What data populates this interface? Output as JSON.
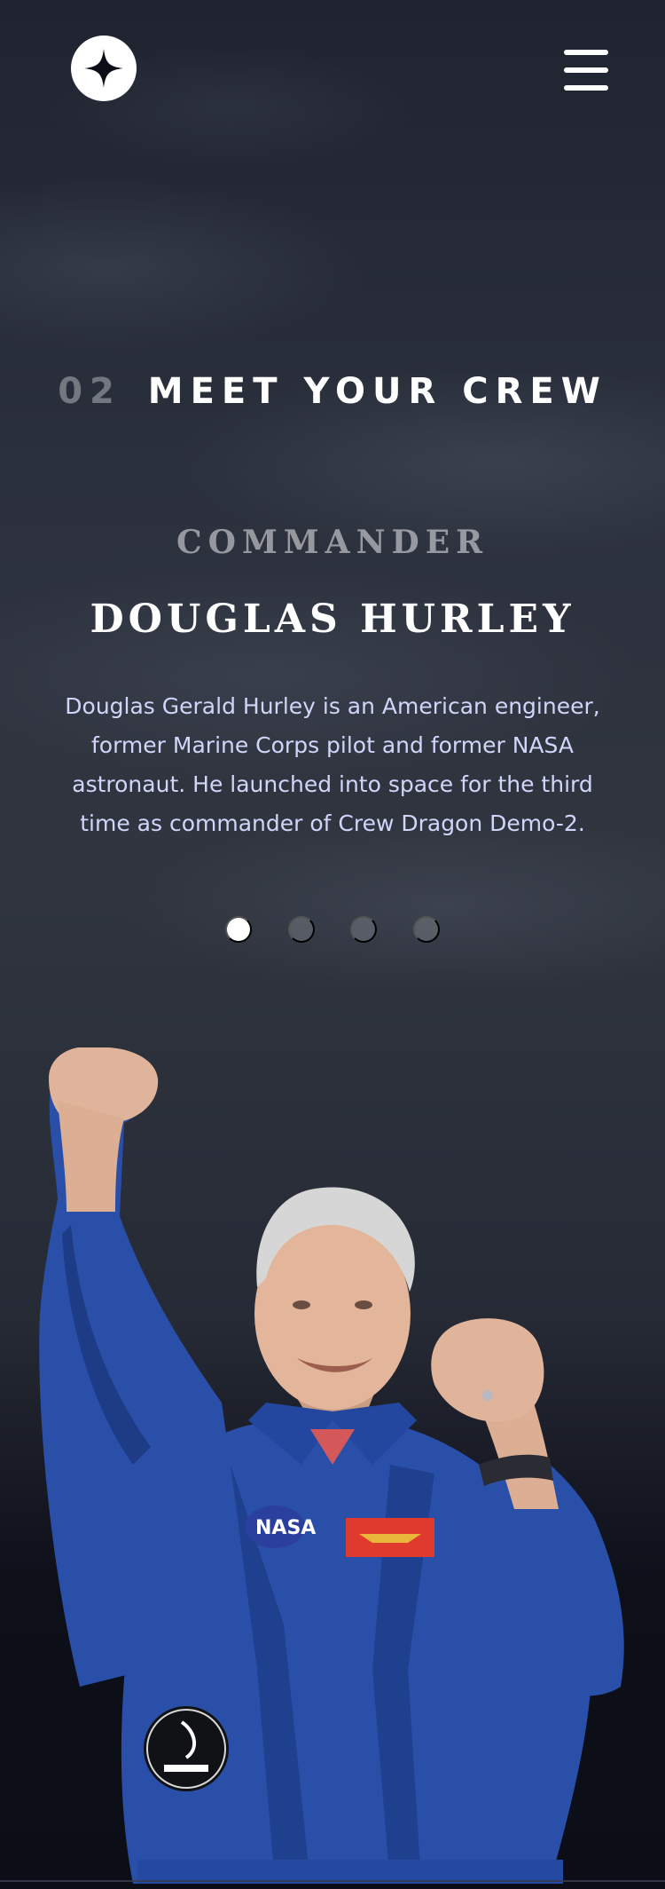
{
  "header": {
    "logo_icon": "star-logo-icon",
    "menu_icon": "hamburger-menu-icon"
  },
  "page": {
    "number": "02",
    "title": "Meet your crew"
  },
  "crew": {
    "role": "Commander",
    "name": "Douglas Hurley",
    "bio": "Douglas Gerald Hurley is an American engineer, former Marine Corps pilot and former NASA astronaut. He launched into space for the third time as commander of Crew Dragon Demo-2."
  },
  "pagination": {
    "count": 4,
    "active_index": 0
  },
  "portrait": {
    "subject": "crew-portrait-image"
  },
  "colors": {
    "background": "#0b0d17",
    "text_primary": "#ffffff",
    "text_secondary": "#d0d6f9",
    "suit_blue": "#2a4fa8"
  }
}
